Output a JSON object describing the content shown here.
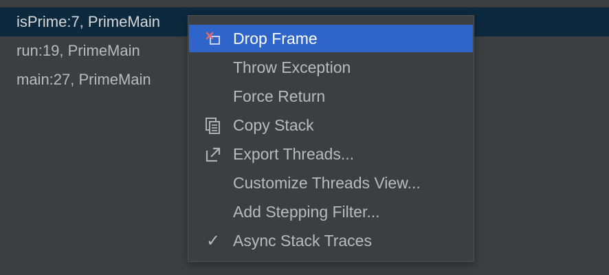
{
  "frames": [
    {
      "label": "isPrime:7, PrimeMain"
    },
    {
      "label": "run:19, PrimeMain"
    },
    {
      "label": "main:27, PrimeMain"
    }
  ],
  "context_menu": {
    "items": [
      {
        "label": "Drop Frame",
        "icon": "drop-frame-icon",
        "highlighted": true
      },
      {
        "label": "Throw Exception",
        "icon": null
      },
      {
        "label": "Force Return",
        "icon": null
      },
      {
        "label": "Copy Stack",
        "icon": "copy-icon"
      },
      {
        "label": "Export Threads...",
        "icon": "export-icon"
      },
      {
        "label": "Customize Threads View...",
        "icon": null
      },
      {
        "label": "Add Stepping Filter...",
        "icon": null
      },
      {
        "label": "Async Stack Traces",
        "icon": "checkmark-icon",
        "checked": true
      }
    ]
  },
  "colors": {
    "background": "#3c3f41",
    "selected_row": "#0d293e",
    "menu_highlight": "#2f65ca",
    "text": "#bbbbbb",
    "drop_icon_red": "#d9534f"
  }
}
